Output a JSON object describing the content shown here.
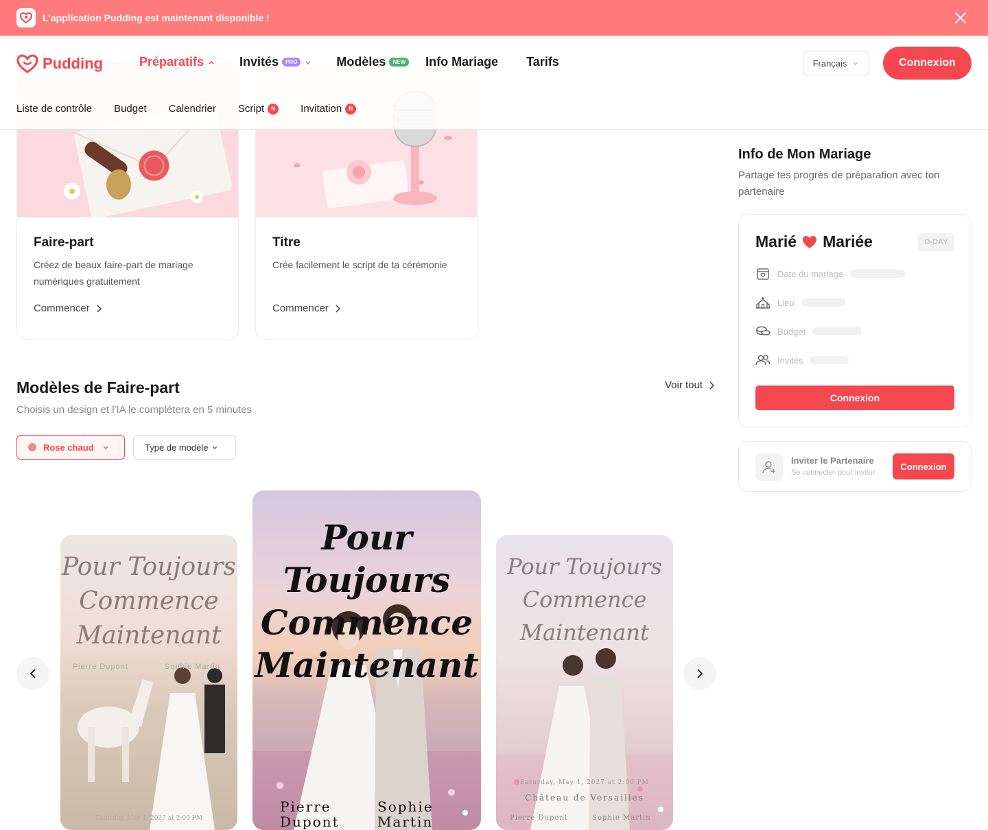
{
  "banner": {
    "text": "L'application Pudding est maintenant disponible !"
  },
  "brand": {
    "name": "Pudding",
    "accent": "#f5474f"
  },
  "nav": {
    "preparatifs": "Préparatifs",
    "invites": "Invités",
    "invites_badge": "PRO",
    "modeles": "Modèles",
    "modeles_badge": "NEW",
    "info": "Info Mariage",
    "tarifs": "Tarifs"
  },
  "language": "Français",
  "login": "Connexion",
  "subnav": {
    "checklist": "Liste de contrôle",
    "budget": "Budget",
    "calendar": "Calendrier",
    "script": "Script",
    "invitation": "Invitation",
    "badge": "N"
  },
  "cards": [
    {
      "title": "Faire-part",
      "desc": "Créez de beaux faire-part de mariage numériques gratuitement",
      "link": "Commencer"
    },
    {
      "title": "Titre",
      "desc": "Crée facilement le script de ta cérémonie",
      "link": "Commencer"
    }
  ],
  "templates": {
    "title": "Modèles de Faire-part",
    "subtitle": "Choisis un design et l'IA le complétera en 5 minutes",
    "view_all": "Voir tout",
    "filter_color": "Rose chaud",
    "filter_type": "Type de modèle",
    "items": [
      {
        "headline": "Pour Toujours Commence Maintenant",
        "bride": "Pierre Dupont",
        "groom": "Sophie Martin",
        "date": "Saturday, May 1, 2027 at 2:00 PM"
      },
      {
        "headline": "Pour Toujours Commence Maintenant",
        "bride": "Pierre Dupont",
        "groom": "Sophie Martin"
      },
      {
        "headline": "Pour Toujours Commence Maintenant",
        "date": "Saturday, May 1, 2027 at 2:00 PM",
        "venue": "Château de Versailles",
        "bride": "Pierre Dupont",
        "groom": "Sophie Martin"
      }
    ]
  },
  "sidebar": {
    "title": "Info de Mon Mariage",
    "subtitle": "Partage tes progrès de préparation avec ton partenaire",
    "groom": "Marié",
    "bride": "Mariée",
    "dday": "D-DAY",
    "rows": [
      "Date du mariage",
      "Lieu",
      "Budget",
      "Invités"
    ],
    "login": "Connexion",
    "partner_title": "Inviter le Partenaire",
    "partner_sub": "Se connecter pour inviter",
    "partner_btn": "Connexion"
  }
}
